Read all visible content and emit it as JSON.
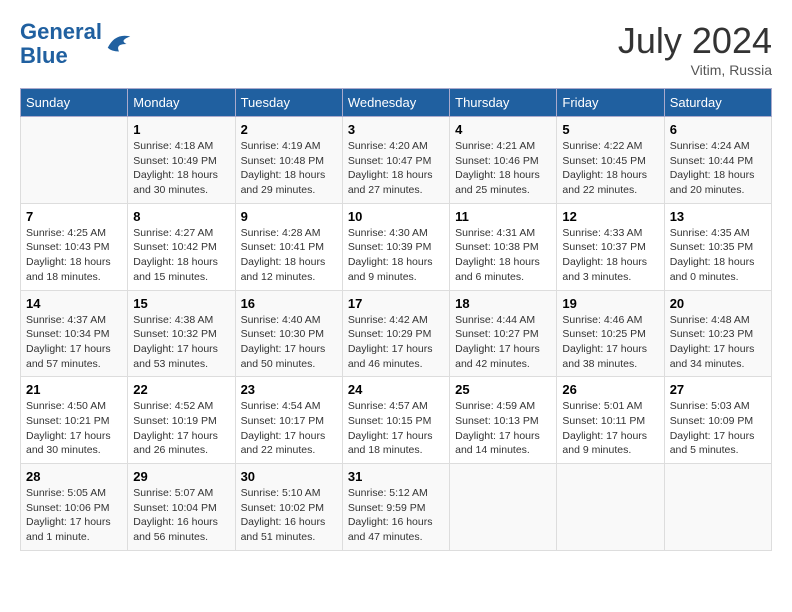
{
  "header": {
    "logo_line1": "General",
    "logo_line2": "Blue",
    "month": "July 2024",
    "location": "Vitim, Russia"
  },
  "weekdays": [
    "Sunday",
    "Monday",
    "Tuesday",
    "Wednesday",
    "Thursday",
    "Friday",
    "Saturday"
  ],
  "weeks": [
    [
      {
        "day": "",
        "sunrise": "",
        "sunset": "",
        "daylight": ""
      },
      {
        "day": "1",
        "sunrise": "Sunrise: 4:18 AM",
        "sunset": "Sunset: 10:49 PM",
        "daylight": "Daylight: 18 hours and 30 minutes."
      },
      {
        "day": "2",
        "sunrise": "Sunrise: 4:19 AM",
        "sunset": "Sunset: 10:48 PM",
        "daylight": "Daylight: 18 hours and 29 minutes."
      },
      {
        "day": "3",
        "sunrise": "Sunrise: 4:20 AM",
        "sunset": "Sunset: 10:47 PM",
        "daylight": "Daylight: 18 hours and 27 minutes."
      },
      {
        "day": "4",
        "sunrise": "Sunrise: 4:21 AM",
        "sunset": "Sunset: 10:46 PM",
        "daylight": "Daylight: 18 hours and 25 minutes."
      },
      {
        "day": "5",
        "sunrise": "Sunrise: 4:22 AM",
        "sunset": "Sunset: 10:45 PM",
        "daylight": "Daylight: 18 hours and 22 minutes."
      },
      {
        "day": "6",
        "sunrise": "Sunrise: 4:24 AM",
        "sunset": "Sunset: 10:44 PM",
        "daylight": "Daylight: 18 hours and 20 minutes."
      }
    ],
    [
      {
        "day": "7",
        "sunrise": "Sunrise: 4:25 AM",
        "sunset": "Sunset: 10:43 PM",
        "daylight": "Daylight: 18 hours and 18 minutes."
      },
      {
        "day": "8",
        "sunrise": "Sunrise: 4:27 AM",
        "sunset": "Sunset: 10:42 PM",
        "daylight": "Daylight: 18 hours and 15 minutes."
      },
      {
        "day": "9",
        "sunrise": "Sunrise: 4:28 AM",
        "sunset": "Sunset: 10:41 PM",
        "daylight": "Daylight: 18 hours and 12 minutes."
      },
      {
        "day": "10",
        "sunrise": "Sunrise: 4:30 AM",
        "sunset": "Sunset: 10:39 PM",
        "daylight": "Daylight: 18 hours and 9 minutes."
      },
      {
        "day": "11",
        "sunrise": "Sunrise: 4:31 AM",
        "sunset": "Sunset: 10:38 PM",
        "daylight": "Daylight: 18 hours and 6 minutes."
      },
      {
        "day": "12",
        "sunrise": "Sunrise: 4:33 AM",
        "sunset": "Sunset: 10:37 PM",
        "daylight": "Daylight: 18 hours and 3 minutes."
      },
      {
        "day": "13",
        "sunrise": "Sunrise: 4:35 AM",
        "sunset": "Sunset: 10:35 PM",
        "daylight": "Daylight: 18 hours and 0 minutes."
      }
    ],
    [
      {
        "day": "14",
        "sunrise": "Sunrise: 4:37 AM",
        "sunset": "Sunset: 10:34 PM",
        "daylight": "Daylight: 17 hours and 57 minutes."
      },
      {
        "day": "15",
        "sunrise": "Sunrise: 4:38 AM",
        "sunset": "Sunset: 10:32 PM",
        "daylight": "Daylight: 17 hours and 53 minutes."
      },
      {
        "day": "16",
        "sunrise": "Sunrise: 4:40 AM",
        "sunset": "Sunset: 10:30 PM",
        "daylight": "Daylight: 17 hours and 50 minutes."
      },
      {
        "day": "17",
        "sunrise": "Sunrise: 4:42 AM",
        "sunset": "Sunset: 10:29 PM",
        "daylight": "Daylight: 17 hours and 46 minutes."
      },
      {
        "day": "18",
        "sunrise": "Sunrise: 4:44 AM",
        "sunset": "Sunset: 10:27 PM",
        "daylight": "Daylight: 17 hours and 42 minutes."
      },
      {
        "day": "19",
        "sunrise": "Sunrise: 4:46 AM",
        "sunset": "Sunset: 10:25 PM",
        "daylight": "Daylight: 17 hours and 38 minutes."
      },
      {
        "day": "20",
        "sunrise": "Sunrise: 4:48 AM",
        "sunset": "Sunset: 10:23 PM",
        "daylight": "Daylight: 17 hours and 34 minutes."
      }
    ],
    [
      {
        "day": "21",
        "sunrise": "Sunrise: 4:50 AM",
        "sunset": "Sunset: 10:21 PM",
        "daylight": "Daylight: 17 hours and 30 minutes."
      },
      {
        "day": "22",
        "sunrise": "Sunrise: 4:52 AM",
        "sunset": "Sunset: 10:19 PM",
        "daylight": "Daylight: 17 hours and 26 minutes."
      },
      {
        "day": "23",
        "sunrise": "Sunrise: 4:54 AM",
        "sunset": "Sunset: 10:17 PM",
        "daylight": "Daylight: 17 hours and 22 minutes."
      },
      {
        "day": "24",
        "sunrise": "Sunrise: 4:57 AM",
        "sunset": "Sunset: 10:15 PM",
        "daylight": "Daylight: 17 hours and 18 minutes."
      },
      {
        "day": "25",
        "sunrise": "Sunrise: 4:59 AM",
        "sunset": "Sunset: 10:13 PM",
        "daylight": "Daylight: 17 hours and 14 minutes."
      },
      {
        "day": "26",
        "sunrise": "Sunrise: 5:01 AM",
        "sunset": "Sunset: 10:11 PM",
        "daylight": "Daylight: 17 hours and 9 minutes."
      },
      {
        "day": "27",
        "sunrise": "Sunrise: 5:03 AM",
        "sunset": "Sunset: 10:09 PM",
        "daylight": "Daylight: 17 hours and 5 minutes."
      }
    ],
    [
      {
        "day": "28",
        "sunrise": "Sunrise: 5:05 AM",
        "sunset": "Sunset: 10:06 PM",
        "daylight": "Daylight: 17 hours and 1 minute."
      },
      {
        "day": "29",
        "sunrise": "Sunrise: 5:07 AM",
        "sunset": "Sunset: 10:04 PM",
        "daylight": "Daylight: 16 hours and 56 minutes."
      },
      {
        "day": "30",
        "sunrise": "Sunrise: 5:10 AM",
        "sunset": "Sunset: 10:02 PM",
        "daylight": "Daylight: 16 hours and 51 minutes."
      },
      {
        "day": "31",
        "sunrise": "Sunrise: 5:12 AM",
        "sunset": "Sunset: 9:59 PM",
        "daylight": "Daylight: 16 hours and 47 minutes."
      },
      {
        "day": "",
        "sunrise": "",
        "sunset": "",
        "daylight": ""
      },
      {
        "day": "",
        "sunrise": "",
        "sunset": "",
        "daylight": ""
      },
      {
        "day": "",
        "sunrise": "",
        "sunset": "",
        "daylight": ""
      }
    ]
  ]
}
